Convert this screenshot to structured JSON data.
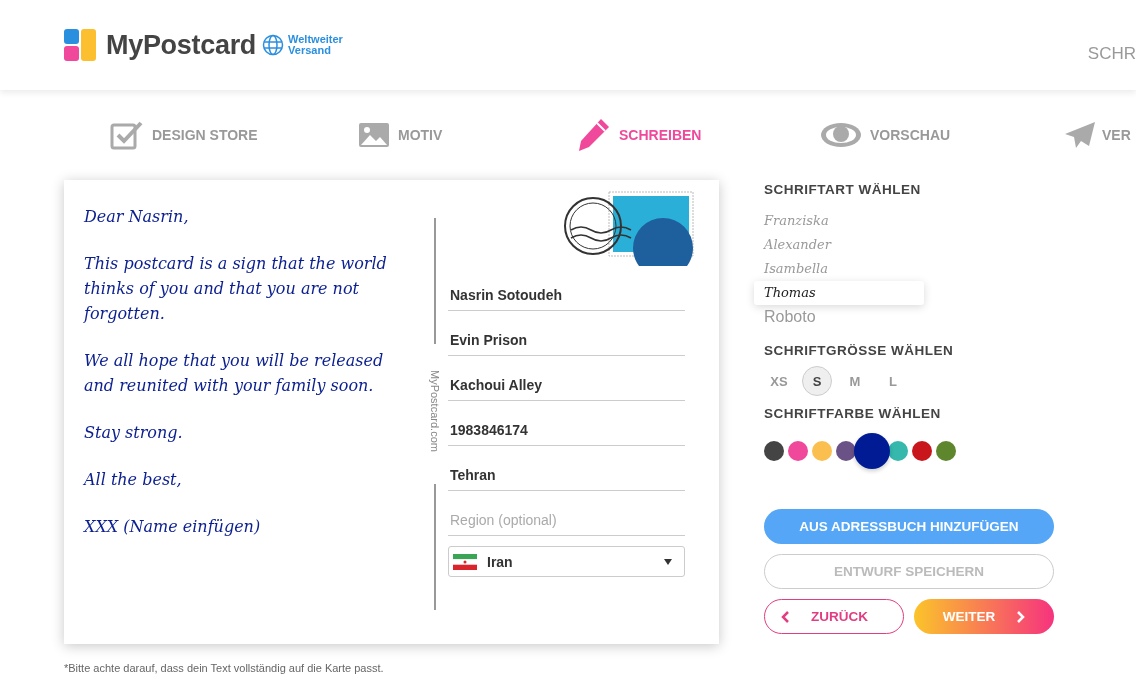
{
  "header": {
    "brand": "MyPostcard",
    "tagline_line1": "Weltweiter",
    "tagline_line2": "Versand",
    "nav_link": "SCHR"
  },
  "steps": [
    {
      "label": "DESIGN STORE",
      "kind": "checkbox",
      "selected": false
    },
    {
      "label": "MOTIV",
      "kind": "image",
      "selected": false
    },
    {
      "label": "SCHREIBEN",
      "kind": "pencil",
      "selected": true
    },
    {
      "label": "VORSCHAU",
      "kind": "eye",
      "selected": false
    },
    {
      "label": "VER",
      "kind": "plane",
      "selected": false
    }
  ],
  "card": {
    "message": [
      "Dear Nasrin,",
      "This postcard is a sign that the world thinks of you and that you are not forgotten.",
      "We all hope that you will be released and reunited with your family soon.",
      "Stay strong.",
      "All the best,",
      "XXX (Name einfügen)"
    ],
    "side_text": "MyPostcard.com",
    "address_fields": [
      {
        "value": "Nasrin Sotoudeh"
      },
      {
        "value": "Evin Prison"
      },
      {
        "value": "Kachoui Alley"
      },
      {
        "value": "1983846174"
      },
      {
        "value": "Tehran"
      },
      {
        "placeholder": "Region (optional)"
      }
    ],
    "country": "Iran"
  },
  "panel": {
    "font_heading": "SCHRIFTART WÄHLEN",
    "fonts": [
      {
        "label": "Franziska",
        "kind": "script",
        "selected": false
      },
      {
        "label": "Alexander",
        "kind": "script",
        "selected": false
      },
      {
        "label": "Isambella",
        "kind": "script",
        "selected": false
      },
      {
        "label": "Thomas",
        "kind": "script",
        "selected": true
      },
      {
        "label": "Roboto",
        "kind": "sans",
        "selected": false
      }
    ],
    "size_heading": "SCHRIFTGRÖSSE WÄHLEN",
    "sizes": [
      {
        "label": "XS",
        "selected": false
      },
      {
        "label": "S",
        "selected": true
      },
      {
        "label": "M",
        "selected": false
      },
      {
        "label": "L",
        "selected": false
      }
    ],
    "color_heading": "SCHRIFTFARBE WÄHLEN",
    "colors": [
      {
        "color": "#444444",
        "selected": false
      },
      {
        "color": "#f0489a",
        "selected": false
      },
      {
        "color": "#fbbf4f",
        "selected": false
      },
      {
        "color": "#6a5287",
        "selected": false
      },
      {
        "color": "#001b94",
        "selected": true
      },
      {
        "color": "#36b8ad",
        "selected": false
      },
      {
        "color": "#c9161c",
        "selected": false
      },
      {
        "color": "#5e862c",
        "selected": false
      }
    ],
    "buttons": [
      {
        "label": "AUS ADRESSBUCH HINZUFÜGEN",
        "kind": "primary"
      },
      {
        "label": "ENTWURF SPEICHERN",
        "kind": "outline"
      },
      {
        "label": "ZURÜCK",
        "kind": "back"
      },
      {
        "label": "WEITER",
        "kind": "next"
      }
    ]
  },
  "footnote": "*Bitte achte darauf, dass dein Text vollständig auf die Karte passt."
}
